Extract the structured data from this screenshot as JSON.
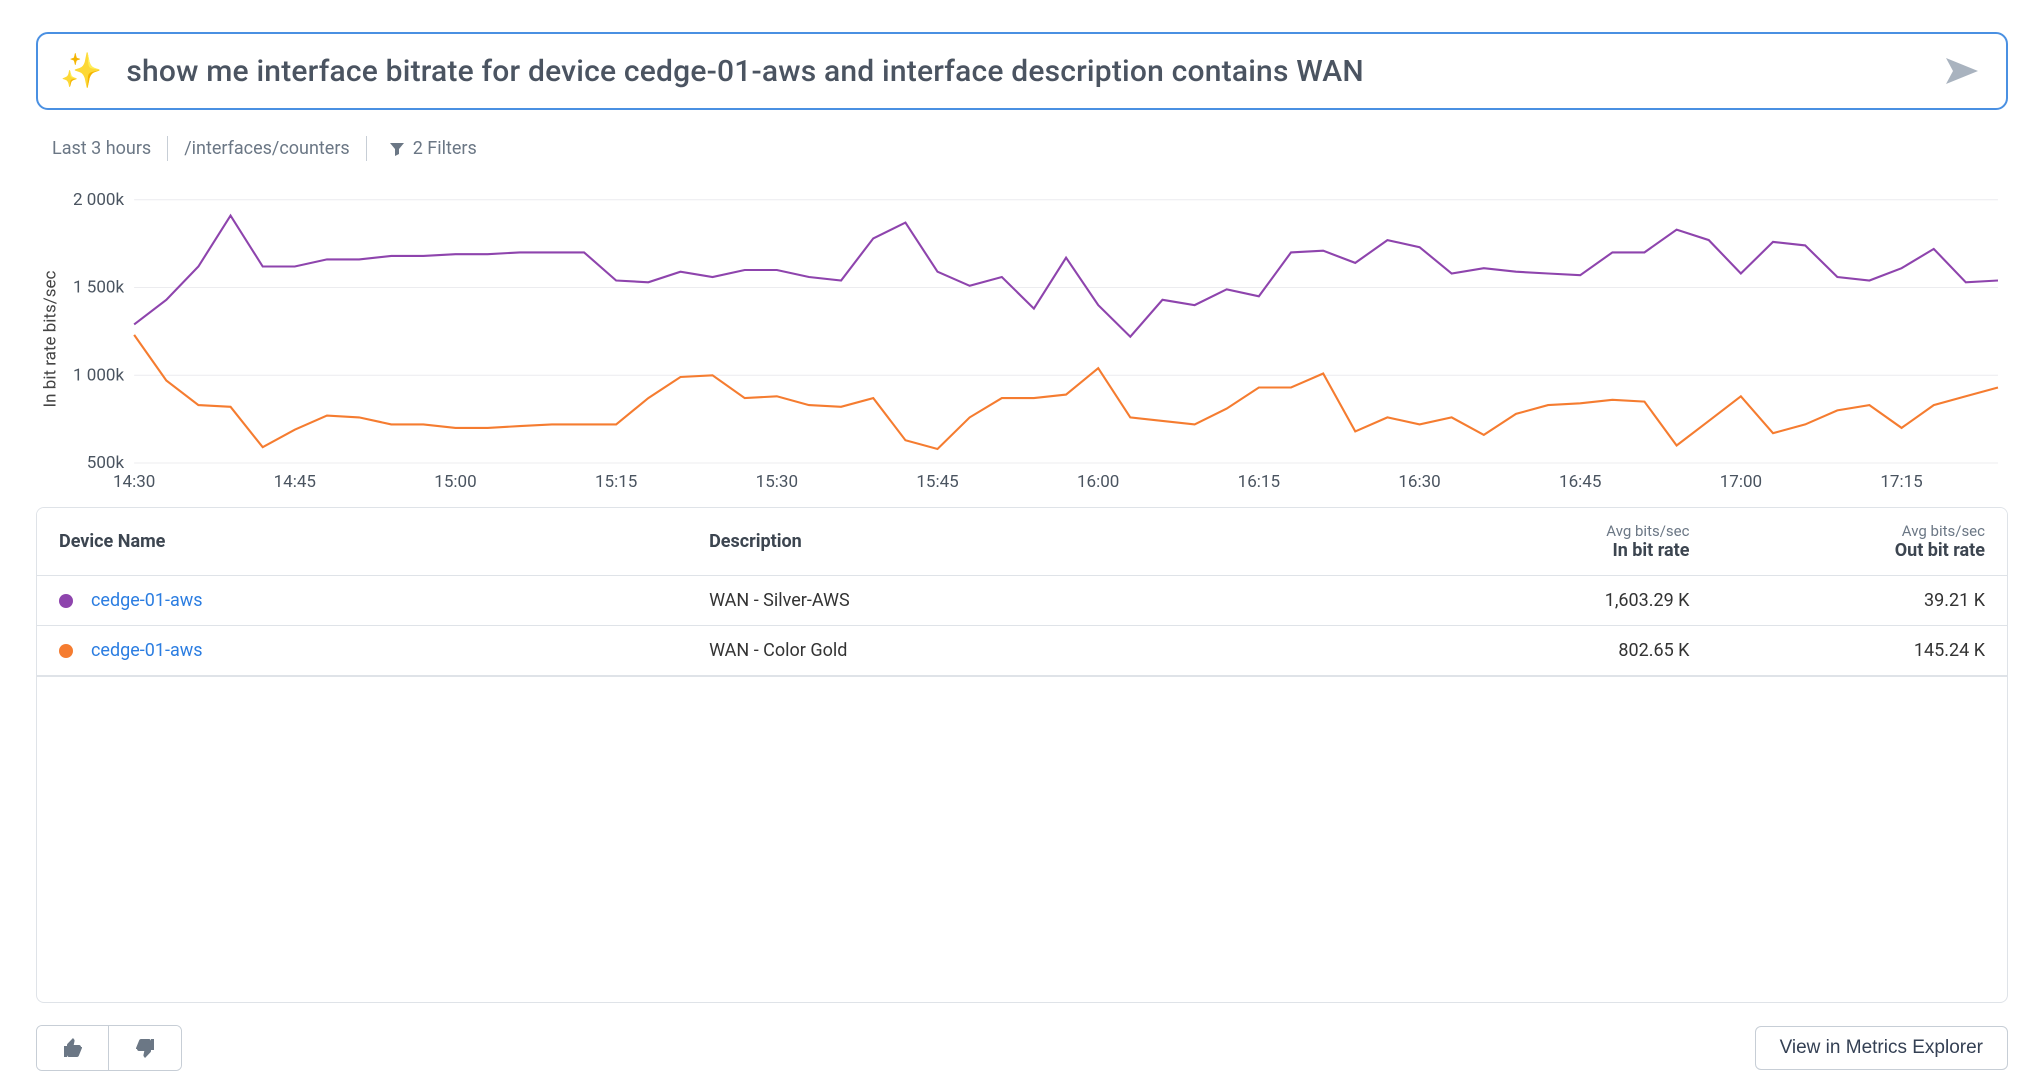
{
  "search": {
    "query": "show me interface bitrate for device cedge-01-aws and interface description contains WAN"
  },
  "chips": {
    "time_range": "Last 3 hours",
    "path": "/interfaces/counters",
    "filter_count": "2 Filters"
  },
  "chart_data": {
    "type": "line",
    "ylabel": "In bit rate bits/sec",
    "ylim": [
      500,
      2050
    ],
    "y_ticks": [
      "500k",
      "1 000k",
      "1 500k",
      "2 000k"
    ],
    "x": [
      "14:30",
      "14:33",
      "14:36",
      "14:39",
      "14:42",
      "14:45",
      "14:48",
      "14:51",
      "14:54",
      "14:57",
      "15:00",
      "15:03",
      "15:06",
      "15:09",
      "15:12",
      "15:15",
      "15:18",
      "15:21",
      "15:24",
      "15:27",
      "15:30",
      "15:33",
      "15:36",
      "15:39",
      "15:42",
      "15:45",
      "15:48",
      "15:51",
      "15:54",
      "15:57",
      "16:00",
      "16:03",
      "16:06",
      "16:09",
      "16:12",
      "16:15",
      "16:18",
      "16:21",
      "16:24",
      "16:27",
      "16:30",
      "16:33",
      "16:36",
      "16:39",
      "16:42",
      "16:45",
      "16:48",
      "16:51",
      "16:54",
      "16:57",
      "17:00",
      "17:03",
      "17:06",
      "17:09",
      "17:12",
      "17:15",
      "17:18",
      "17:21",
      "17:24"
    ],
    "x_ticks": [
      "14:30",
      "14:45",
      "15:00",
      "15:15",
      "15:30",
      "15:45",
      "16:00",
      "16:15",
      "16:30",
      "16:45",
      "17:00",
      "17:15"
    ],
    "series": [
      {
        "name": "cedge-01-aws — WAN - Silver-AWS",
        "color": "#8e44ad",
        "values": [
          1290,
          1430,
          1620,
          1910,
          1620,
          1620,
          1660,
          1660,
          1680,
          1680,
          1690,
          1690,
          1700,
          1700,
          1700,
          1540,
          1530,
          1590,
          1560,
          1600,
          1600,
          1560,
          1540,
          1780,
          1870,
          1590,
          1510,
          1560,
          1380,
          1670,
          1400,
          1220,
          1430,
          1400,
          1490,
          1450,
          1700,
          1710,
          1640,
          1770,
          1730,
          1580,
          1610,
          1590,
          1580,
          1570,
          1700,
          1700,
          1830,
          1770,
          1580,
          1760,
          1740,
          1560,
          1540,
          1610,
          1720,
          1530,
          1540
        ]
      },
      {
        "name": "cedge-01-aws — WAN - Color Gold",
        "color": "#f57c30",
        "values": [
          1230,
          970,
          830,
          820,
          590,
          690,
          770,
          760,
          720,
          720,
          700,
          700,
          710,
          720,
          720,
          720,
          870,
          990,
          1000,
          870,
          880,
          830,
          820,
          870,
          630,
          580,
          760,
          870,
          870,
          890,
          1040,
          760,
          740,
          720,
          810,
          930,
          930,
          1010,
          680,
          760,
          720,
          760,
          660,
          780,
          830,
          840,
          860,
          850,
          600,
          740,
          880,
          670,
          720,
          800,
          830,
          700,
          830,
          880,
          930
        ]
      }
    ]
  },
  "table": {
    "headers": {
      "device": "Device Name",
      "description": "Description",
      "in_small": "Avg bits/sec",
      "in": "In bit rate",
      "out_small": "Avg bits/sec",
      "out": "Out bit rate"
    },
    "rows": [
      {
        "color": "#8e44ad",
        "device": "cedge-01-aws",
        "description": "WAN - Silver-AWS",
        "in": "1,603.29 K",
        "out": "39.21 K"
      },
      {
        "color": "#f57c30",
        "device": "cedge-01-aws",
        "description": "WAN - Color Gold",
        "in": "802.65 K",
        "out": "145.24 K"
      }
    ]
  },
  "footer": {
    "view_label": "View in Metrics Explorer"
  }
}
